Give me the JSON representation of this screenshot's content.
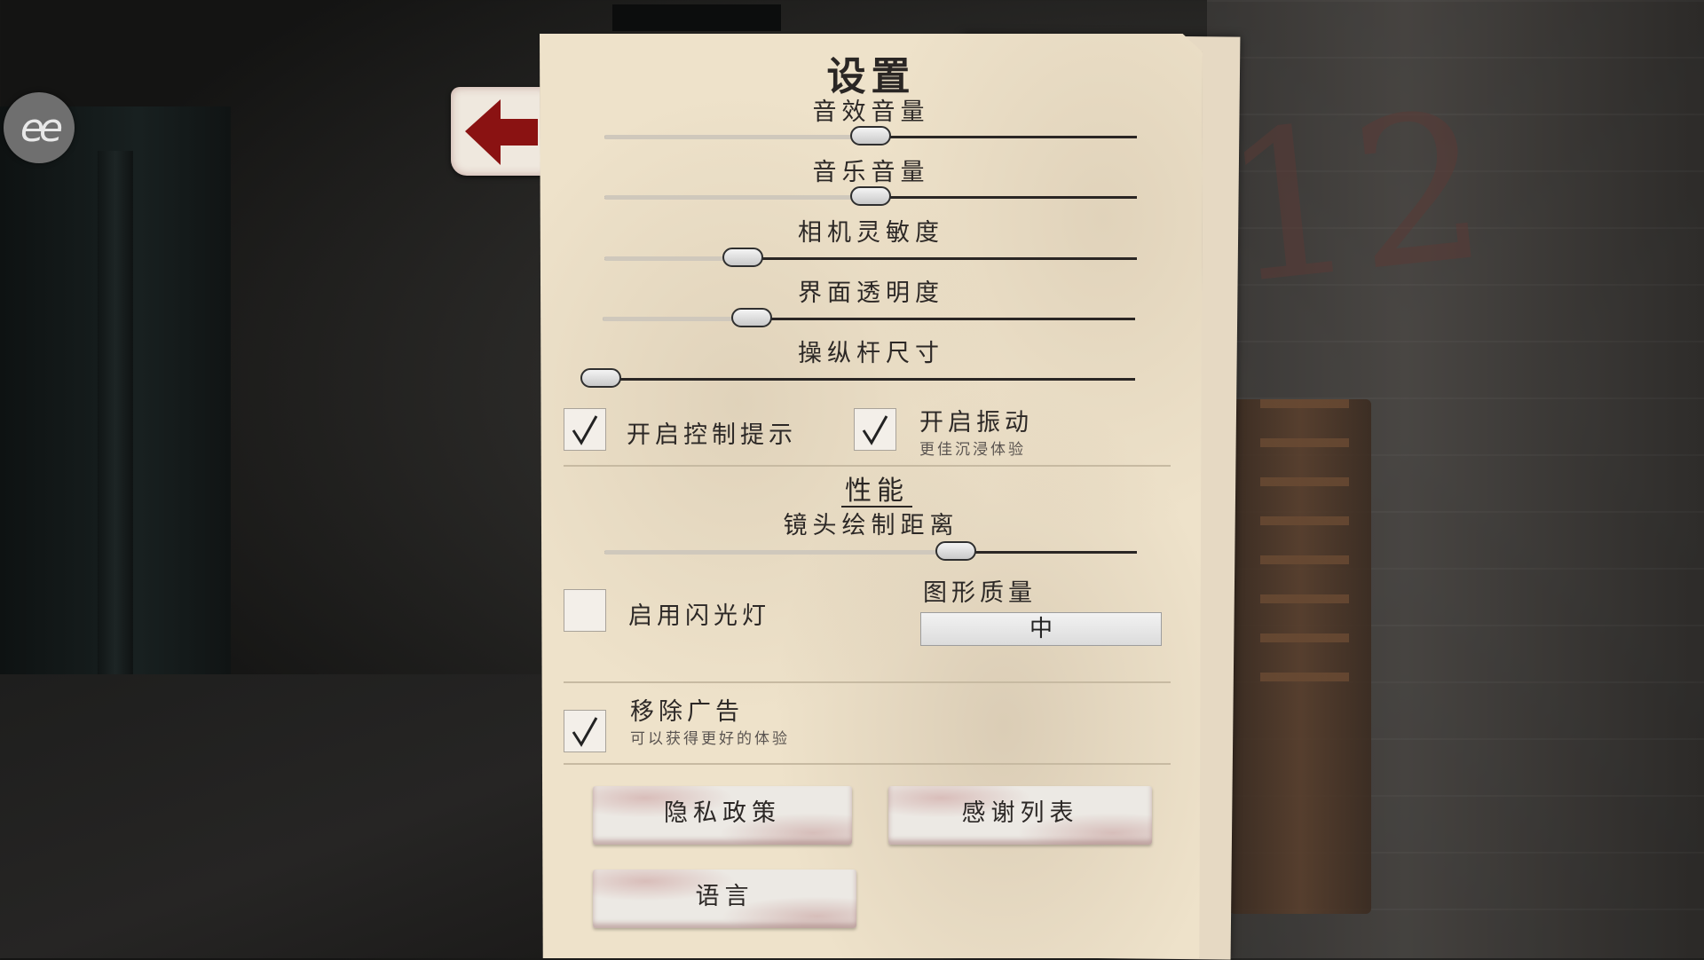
{
  "logo": {
    "text": "ee"
  },
  "settings": {
    "title": "设置",
    "sliders": [
      {
        "label": "音效音量",
        "value": 0.5
      },
      {
        "label": "音乐音量",
        "value": 0.5
      },
      {
        "label": "相机灵敏度",
        "value": 0.26
      },
      {
        "label": "界面透明度",
        "value": 0.28
      },
      {
        "label": "操纵杆尺寸",
        "value": 0.0
      }
    ],
    "control_hints": {
      "label": "开启控制提示",
      "checked": true
    },
    "vibration": {
      "label": "开启振动",
      "sublabel": "更佳沉浸体验",
      "checked": true
    },
    "performance": {
      "title": "性能",
      "draw_distance": {
        "label": "镜头绘制距离",
        "value": 0.66
      },
      "flashlight": {
        "label": "启用闪光灯",
        "checked": false
      },
      "graphics_quality": {
        "label": "图形质量",
        "value": "中"
      }
    },
    "remove_ads": {
      "label": "移除广告",
      "sublabel": "可以获得更好的体验",
      "checked": true
    },
    "buttons": {
      "privacy": "隐私政策",
      "credits": "感谢列表",
      "language": "语言"
    }
  }
}
